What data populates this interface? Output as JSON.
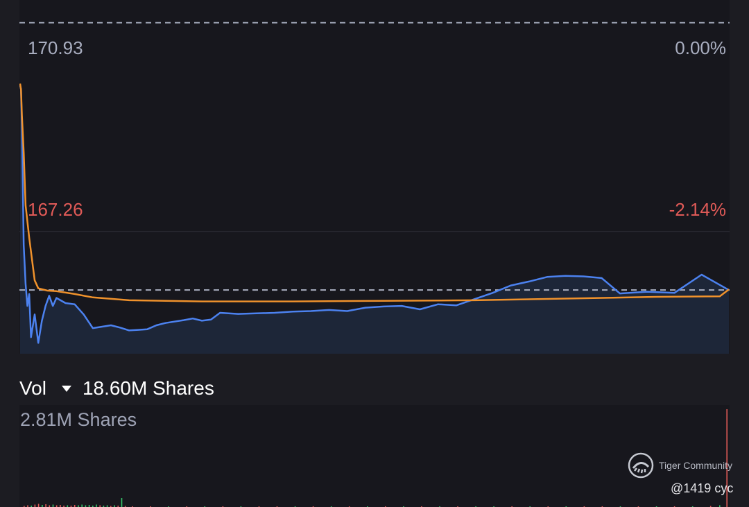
{
  "chart_data": {
    "type": "line",
    "title": "",
    "xlabel": "",
    "ylabel": "",
    "reference_price": 170.93,
    "ylim": [
      165.11,
      171.33
    ],
    "y_tick_labels": [
      {
        "value": 170.93,
        "price_label": "170.93",
        "pct_label": "0.00%",
        "style": "dashed"
      },
      {
        "value": 167.26,
        "price_label": "167.26",
        "pct_label": "-2.14%",
        "style": "solid"
      }
    ],
    "current_price_line": 166.23,
    "series": [
      {
        "name": "",
        "color": "#4c82f0",
        "role": "price",
        "x": [
          0,
          0.5,
          1,
          1.5,
          2,
          3,
          4,
          5,
          6,
          8,
          10,
          12,
          14,
          16,
          18,
          20,
          25,
          30,
          35,
          40,
          50,
          55,
          60,
          65,
          70,
          75,
          80,
          90,
          95,
          100,
          105,
          110,
          120,
          130,
          140,
          150,
          160,
          170,
          180,
          190,
          200,
          210,
          220,
          230,
          240,
          250,
          260,
          270,
          280,
          290,
          300,
          310,
          320,
          330,
          345,
          360,
          375,
          390
        ],
        "values": [
          169.83,
          169.76,
          169.12,
          168.05,
          167.02,
          166.34,
          165.95,
          166.16,
          165.4,
          165.8,
          165.3,
          165.69,
          165.95,
          166.13,
          165.95,
          166.09,
          166.0,
          165.98,
          165.8,
          165.56,
          165.61,
          165.57,
          165.52,
          165.53,
          165.54,
          165.61,
          165.65,
          165.7,
          165.73,
          165.69,
          165.71,
          165.83,
          165.81,
          165.82,
          165.83,
          165.85,
          165.86,
          165.88,
          165.86,
          165.92,
          165.94,
          165.95,
          165.89,
          165.98,
          165.96,
          166.07,
          166.18,
          166.31,
          166.38,
          166.46,
          166.48,
          166.47,
          166.44,
          166.17,
          166.2,
          166.18,
          166.5,
          166.23
        ]
      },
      {
        "name": "",
        "color": "#f0922c",
        "role": "average",
        "x": [
          0,
          0.5,
          1,
          2,
          3,
          5,
          8,
          10,
          15,
          20,
          30,
          40,
          60,
          80,
          100,
          120,
          150,
          200,
          250,
          300,
          350,
          385,
          390
        ],
        "values": [
          169.86,
          169.75,
          169.3,
          168.65,
          167.72,
          167.15,
          166.4,
          166.26,
          166.22,
          166.21,
          166.16,
          166.1,
          166.05,
          166.04,
          166.03,
          166.03,
          166.03,
          166.04,
          166.05,
          166.08,
          166.11,
          166.12,
          166.24
        ]
      }
    ],
    "x_domain": [
      0,
      390
    ],
    "grid": true,
    "legend": "none"
  },
  "volume": {
    "header_label": "Vol",
    "total": "18.60M Shares",
    "max_label": "2.81M Shares",
    "ylim": [
      0,
      2.81
    ],
    "up_color": "#35c46a",
    "down_color": "#e05a57",
    "bars": [
      {
        "x": 0,
        "value": 0.03,
        "dir": "down"
      },
      {
        "x": 2,
        "value": 0.05,
        "dir": "down"
      },
      {
        "x": 4,
        "value": 0.04,
        "dir": "up"
      },
      {
        "x": 6,
        "value": 0.07,
        "dir": "down"
      },
      {
        "x": 8,
        "value": 0.09,
        "dir": "down"
      },
      {
        "x": 10,
        "value": 0.06,
        "dir": "up"
      },
      {
        "x": 12,
        "value": 0.08,
        "dir": "down"
      },
      {
        "x": 14,
        "value": 0.05,
        "dir": "down"
      },
      {
        "x": 16,
        "value": 0.07,
        "dir": "up"
      },
      {
        "x": 18,
        "value": 0.05,
        "dir": "down"
      },
      {
        "x": 20,
        "value": 0.06,
        "dir": "down"
      },
      {
        "x": 22,
        "value": 0.04,
        "dir": "down"
      },
      {
        "x": 24,
        "value": 0.05,
        "dir": "up"
      },
      {
        "x": 26,
        "value": 0.04,
        "dir": "down"
      },
      {
        "x": 28,
        "value": 0.06,
        "dir": "down"
      },
      {
        "x": 30,
        "value": 0.05,
        "dir": "up"
      },
      {
        "x": 32,
        "value": 0.07,
        "dir": "up"
      },
      {
        "x": 34,
        "value": 0.05,
        "dir": "up"
      },
      {
        "x": 36,
        "value": 0.06,
        "dir": "up"
      },
      {
        "x": 38,
        "value": 0.04,
        "dir": "up"
      },
      {
        "x": 40,
        "value": 0.07,
        "dir": "up"
      },
      {
        "x": 42,
        "value": 0.05,
        "dir": "down"
      },
      {
        "x": 44,
        "value": 0.04,
        "dir": "up"
      },
      {
        "x": 46,
        "value": 0.05,
        "dir": "up"
      },
      {
        "x": 48,
        "value": 0.03,
        "dir": "down"
      },
      {
        "x": 50,
        "value": 0.05,
        "dir": "up"
      },
      {
        "x": 52,
        "value": 0.04,
        "dir": "down"
      },
      {
        "x": 54,
        "value": 0.26,
        "dir": "up"
      },
      {
        "x": 56,
        "value": 0.03,
        "dir": "down"
      },
      {
        "x": 60,
        "value": 0.02,
        "dir": "down"
      },
      {
        "x": 70,
        "value": 0.02,
        "dir": "down"
      },
      {
        "x": 80,
        "value": 0.02,
        "dir": "up"
      },
      {
        "x": 90,
        "value": 0.02,
        "dir": "down"
      },
      {
        "x": 100,
        "value": 0.02,
        "dir": "up"
      },
      {
        "x": 110,
        "value": 0.02,
        "dir": "down"
      },
      {
        "x": 120,
        "value": 0.02,
        "dir": "up"
      },
      {
        "x": 130,
        "value": 0.02,
        "dir": "down"
      },
      {
        "x": 140,
        "value": 0.02,
        "dir": "down"
      },
      {
        "x": 150,
        "value": 0.02,
        "dir": "up"
      },
      {
        "x": 160,
        "value": 0.02,
        "dir": "down"
      },
      {
        "x": 170,
        "value": 0.02,
        "dir": "up"
      },
      {
        "x": 180,
        "value": 0.02,
        "dir": "down"
      },
      {
        "x": 190,
        "value": 0.02,
        "dir": "up"
      },
      {
        "x": 200,
        "value": 0.02,
        "dir": "down"
      },
      {
        "x": 210,
        "value": 0.02,
        "dir": "up"
      },
      {
        "x": 220,
        "value": 0.02,
        "dir": "down"
      },
      {
        "x": 230,
        "value": 0.02,
        "dir": "up"
      },
      {
        "x": 240,
        "value": 0.02,
        "dir": "down"
      },
      {
        "x": 250,
        "value": 0.02,
        "dir": "up"
      },
      {
        "x": 260,
        "value": 0.02,
        "dir": "up"
      },
      {
        "x": 270,
        "value": 0.02,
        "dir": "down"
      },
      {
        "x": 280,
        "value": 0.02,
        "dir": "up"
      },
      {
        "x": 290,
        "value": 0.02,
        "dir": "down"
      },
      {
        "x": 300,
        "value": 0.02,
        "dir": "up"
      },
      {
        "x": 310,
        "value": 0.02,
        "dir": "down"
      },
      {
        "x": 320,
        "value": 0.02,
        "dir": "down"
      },
      {
        "x": 330,
        "value": 0.02,
        "dir": "up"
      },
      {
        "x": 340,
        "value": 0.02,
        "dir": "down"
      },
      {
        "x": 350,
        "value": 0.02,
        "dir": "up"
      },
      {
        "x": 360,
        "value": 0.02,
        "dir": "down"
      },
      {
        "x": 370,
        "value": 0.02,
        "dir": "up"
      },
      {
        "x": 380,
        "value": 0.03,
        "dir": "down"
      },
      {
        "x": 385,
        "value": 0.05,
        "dir": "up"
      },
      {
        "x": 389,
        "value": 2.81,
        "dir": "down"
      }
    ]
  },
  "watermark": {
    "brand": "Tiger Community",
    "user": "@1419 cyc",
    "icon": "tiger-logo-icon"
  },
  "colors": {
    "background": "#1c1c22",
    "panel": "#17171d",
    "ref_price": "#a9aec0",
    "down_label": "#e05a57",
    "price_line": "#4c82f0",
    "avg_line": "#f0922c",
    "price_fill": "#1f2a40"
  }
}
